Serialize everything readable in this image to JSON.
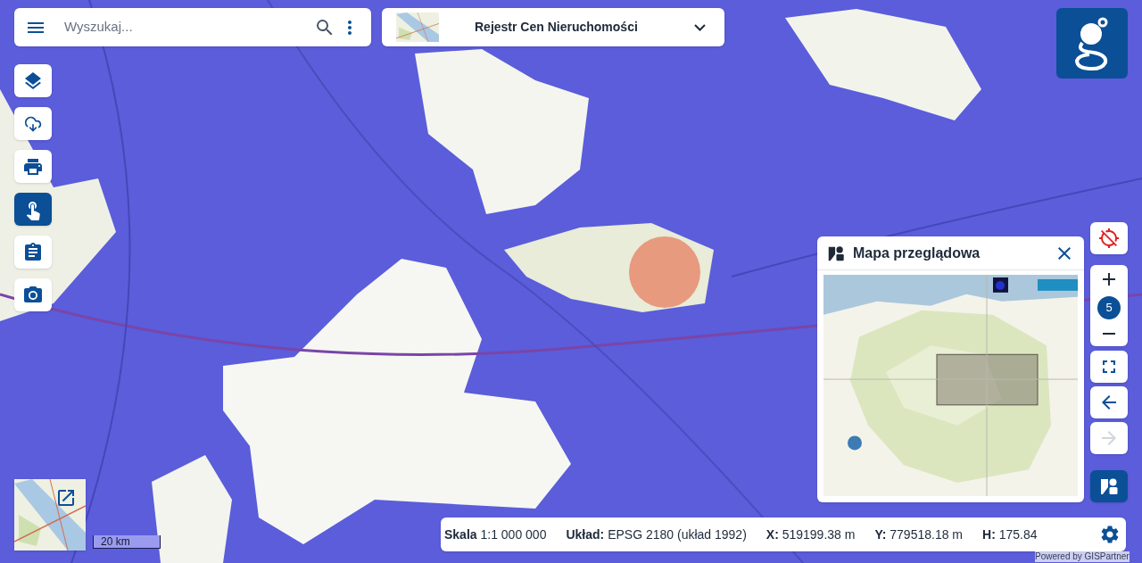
{
  "search": {
    "placeholder": "Wyszukaj..."
  },
  "layer_selector": {
    "title": "Rejestr Cen Nieruchomości"
  },
  "left_tools": [
    {
      "kind": "layers",
      "selected": false
    },
    {
      "kind": "cloud",
      "selected": false
    },
    {
      "kind": "print",
      "selected": false
    },
    {
      "kind": "touch",
      "selected": true
    },
    {
      "kind": "clipboard",
      "selected": false
    },
    {
      "kind": "camera",
      "selected": false
    }
  ],
  "right_tools": {
    "zoom_level": "5",
    "forward_disabled": true,
    "overview_selected": true
  },
  "overview_panel": {
    "title": "Mapa przeglądowa"
  },
  "scale_bar": "20 km",
  "status_bar": [
    {
      "label": "Skala",
      "value": "1:1 000 000"
    },
    {
      "label": "Układ:",
      "value": "EPSG 2180 (układ 1992)"
    },
    {
      "label": "X:",
      "value": "519199.38 m"
    },
    {
      "label": "Y:",
      "value": "779518.18 m"
    },
    {
      "label": "H:",
      "value": "175.84"
    }
  ],
  "credit": "Powered by GISPartner"
}
